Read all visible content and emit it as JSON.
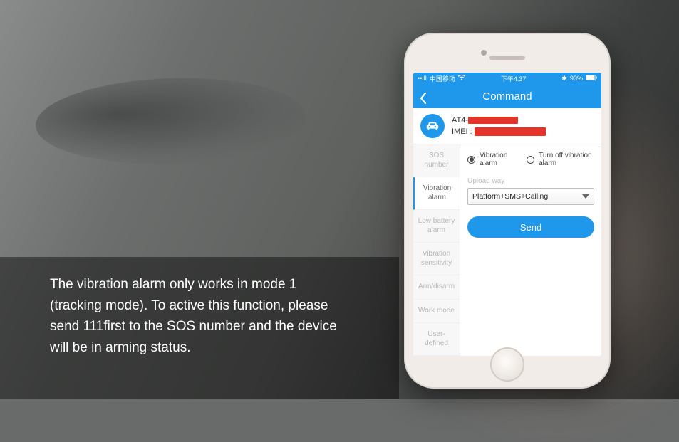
{
  "caption": "The vibration alarm only works in mode 1 (tracking mode). To active this function, please send 111first to the SOS number and the device will be in arming status.",
  "statusbar": {
    "signal": "••ıll",
    "carrier": "中国移动",
    "time": "下午4:37",
    "battery": "93%"
  },
  "nav": {
    "title": "Command"
  },
  "device": {
    "name_prefix": "AT4-",
    "imei_label": "IMEI :"
  },
  "tabs": [
    "SOS number",
    "Vibration alarm",
    "Low battery alarm",
    "Vibration sensitivity",
    "Arm/disarm",
    "Work mode",
    "User-defined"
  ],
  "pane": {
    "radio_on": "Vibration alarm",
    "radio_off": "Turn off vibration alarm",
    "upload_label": "Upload way",
    "upload_value": "Platform+SMS+Calling",
    "send": "Send"
  }
}
